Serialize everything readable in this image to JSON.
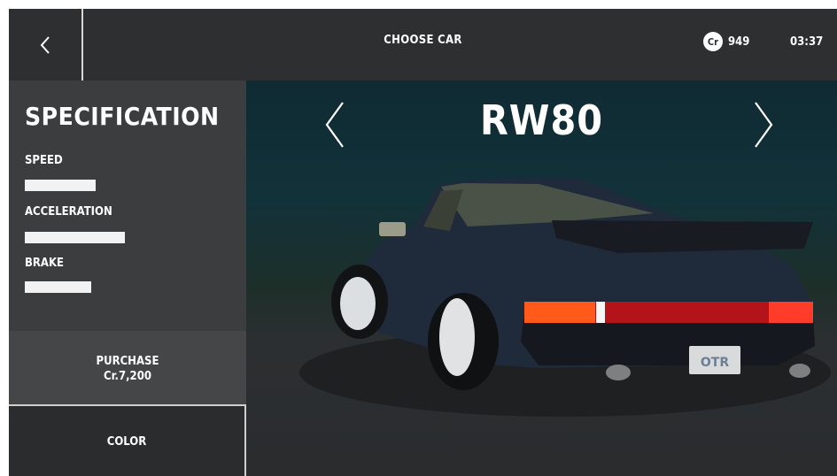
{
  "header": {
    "title": "CHOOSE CAR",
    "credits_badge": "Cr",
    "credits": "949",
    "time": "03:37"
  },
  "specification": {
    "title": "SPECIFICATION",
    "stats": [
      {
        "label": "SPEED",
        "level": 0.3
      },
      {
        "label": "ACCELERATION",
        "level": 0.42
      },
      {
        "label": "BRAKE",
        "level": 0.28
      }
    ]
  },
  "purchase": {
    "label": "PURCHASE",
    "price": "Cr.7,200"
  },
  "color_button": "COLOR",
  "car": {
    "name": "RW80",
    "plate": "OTR",
    "body_color": "#1f2b3a"
  },
  "icons": [
    "chevron-left-icon",
    "chevron-left-icon",
    "chevron-right-icon",
    "credits-coin-icon"
  ]
}
